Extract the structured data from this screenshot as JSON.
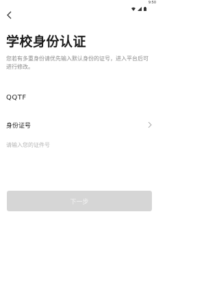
{
  "status_bar": {
    "time": "9:50",
    "icons": [
      "wifi-icon",
      "signal-icon",
      "battery-icon"
    ]
  },
  "header": {
    "back_icon": "chevron-left-icon",
    "title": "学校身份认证"
  },
  "description": "您若有多重身份请优先输入默认身份的证号，进入平台后可进行修改。",
  "school": {
    "name": "QQTF"
  },
  "id_type": {
    "label": "身份证号",
    "icon": "chevron-right-icon"
  },
  "id_number": {
    "value": "",
    "placeholder": "请输入您的证件号"
  },
  "next_button": {
    "label": "下一步",
    "color": "#d6d6d6"
  }
}
